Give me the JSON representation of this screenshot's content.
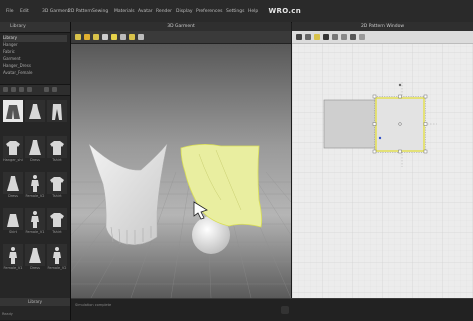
{
  "menu": {
    "items": [
      "File",
      "Edit",
      "3D Garment",
      "2D Pattern",
      "Sewing",
      "Materials",
      "Avatar",
      "Render",
      "Display",
      "Preferences",
      "Settings",
      "Help"
    ],
    "watermark": "WRO.cn"
  },
  "left_panel": {
    "header": "Library",
    "tree": [
      "Library",
      "Hanger",
      "Fabric",
      "Garment",
      "Hanger_Dress",
      "Avatar_Female"
    ],
    "tree_selected": "Library",
    "items": [
      {
        "label": "",
        "icon": "jacket-icon",
        "white": true
      },
      {
        "label": "",
        "icon": "dress-icon",
        "white": false
      },
      {
        "label": "",
        "icon": "pants-icon",
        "white": false
      },
      {
        "label": "Hanger_shirt",
        "icon": "shirt-icon",
        "white": false
      },
      {
        "label": "Dress",
        "icon": "dress-icon",
        "white": false
      },
      {
        "label": "Tshirt",
        "icon": "shirt-icon",
        "white": false
      },
      {
        "label": "Dress",
        "icon": "dress-icon",
        "white": false
      },
      {
        "label": "Female_V2",
        "icon": "avatar-icon",
        "white": false
      },
      {
        "label": "Tshirt",
        "icon": "shirt-icon",
        "white": false
      },
      {
        "label": "Skirt",
        "icon": "skirt-icon",
        "white": false
      },
      {
        "label": "Female_V1",
        "icon": "avatar-icon",
        "white": false
      },
      {
        "label": "Tshirt",
        "icon": "shirt-icon",
        "white": false
      },
      {
        "label": "Female_V1",
        "icon": "avatar-icon",
        "white": false
      },
      {
        "label": "Dress",
        "icon": "dress-icon",
        "white": false
      },
      {
        "label": "Female_V2",
        "icon": "avatar-icon",
        "white": false
      }
    ],
    "footer_button": "Library",
    "status": "Ready"
  },
  "viewport3d": {
    "title": "3D Garment",
    "tool_colors": [
      "#d8c24a",
      "#e0b030",
      "#d8c24a",
      "#cccccc",
      "#e6d24a",
      "#bbbbbb",
      "#d8c24a",
      "#bbbbbb"
    ],
    "accent": "#e6ea90"
  },
  "viewport2d": {
    "title": "2D Pattern Window"
  },
  "bottom": {
    "status": "Simulation complete"
  }
}
